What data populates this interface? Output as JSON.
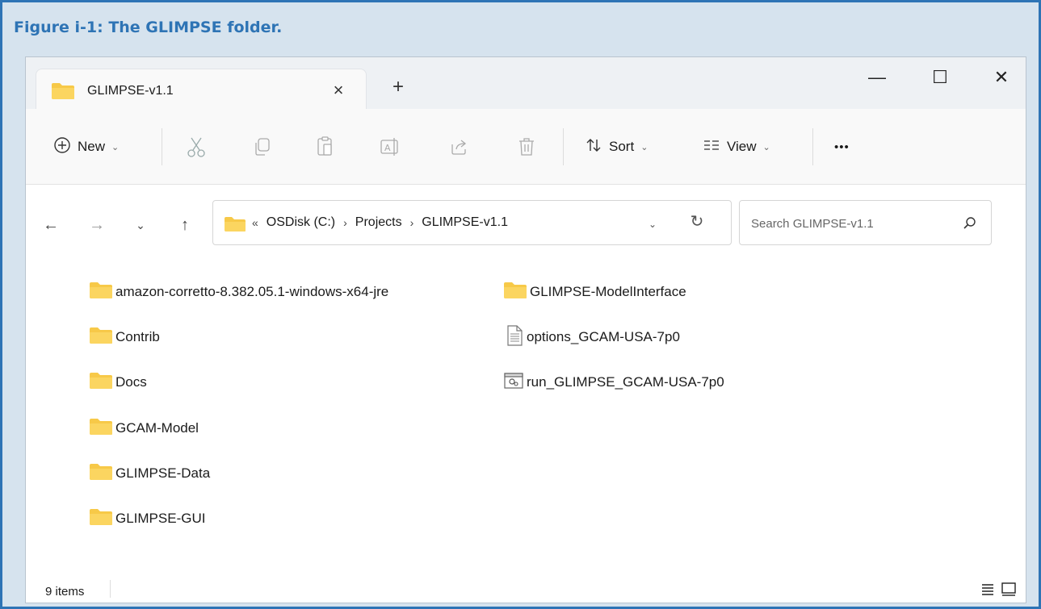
{
  "caption": "Figure i-1: The GLIMPSE folder.",
  "window": {
    "tab_title": "GLIMPSE-v1.1",
    "tab_close": "×",
    "new_tab": "+",
    "minimize": "—",
    "maximize": "☐",
    "close": "✕"
  },
  "toolbar": {
    "new_label": "New",
    "sort_label": "Sort",
    "view_label": "View",
    "more_label": "•••",
    "chevron": "⌄",
    "icons": [
      "cut-icon",
      "copy-icon",
      "paste-icon",
      "rename-icon",
      "share-icon",
      "delete-icon"
    ]
  },
  "nav": {
    "back": "←",
    "forward": "→",
    "recent": "⌄",
    "up": "↑",
    "crumbs": [
      "«",
      "OSDisk (C:)",
      "›",
      "Projects",
      "›",
      "GLIMPSE-v1.1"
    ],
    "dropdown": "⌄",
    "refresh": "↻",
    "search_placeholder": "Search GLIMPSE-v1.1"
  },
  "files": {
    "col1": [
      {
        "name": "amazon-corretto-8.382.05.1-windows-x64-jre",
        "type": "folder"
      },
      {
        "name": "Contrib",
        "type": "folder"
      },
      {
        "name": "Docs",
        "type": "folder"
      },
      {
        "name": "GCAM-Model",
        "type": "folder"
      },
      {
        "name": "GLIMPSE-Data",
        "type": "folder"
      },
      {
        "name": "GLIMPSE-GUI",
        "type": "folder"
      }
    ],
    "col2": [
      {
        "name": "GLIMPSE-ModelInterface",
        "type": "folder"
      },
      {
        "name": "options_GCAM-USA-7p0",
        "type": "text-file"
      },
      {
        "name": "run_GLIMPSE_GCAM-USA-7p0",
        "type": "batch-file"
      }
    ]
  },
  "status": {
    "item_count": "9 items"
  },
  "colors": {
    "caption": "#2e74b5",
    "folder": "#f7c948",
    "background": "#d6e3ee"
  }
}
